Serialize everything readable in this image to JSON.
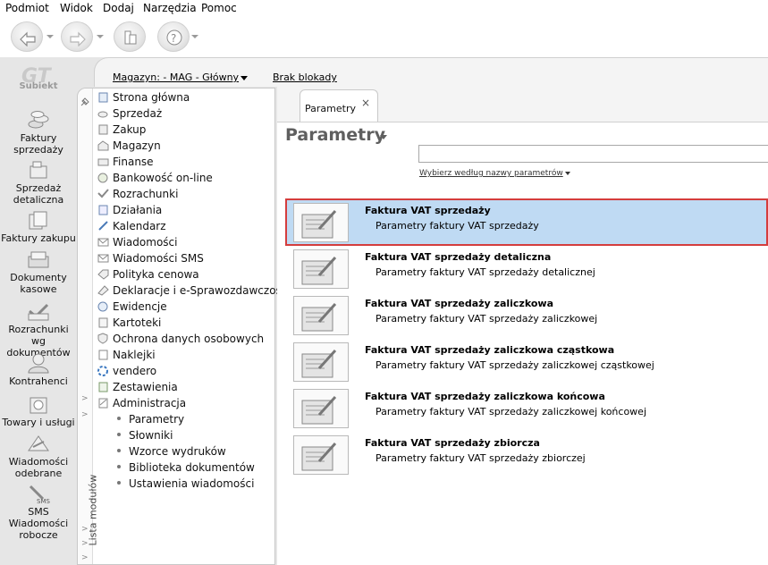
{
  "menu": [
    "Podmiot",
    "Widok",
    "Dodaj",
    "Narzędzia",
    "Pomoc"
  ],
  "logo_text": "Subiekt",
  "modules": [
    {
      "label": "Faktury sprzedaży",
      "icon": "coins-icon"
    },
    {
      "label": "Sprzedaż detaliczna",
      "icon": "cash-register-icon"
    },
    {
      "label": "Faktury zakupu",
      "icon": "invoice-stack-icon"
    },
    {
      "label": "Dokumenty kasowe",
      "icon": "cash-documents-icon"
    },
    {
      "label": "Rozrachunki wg dokumentów",
      "icon": "settlements-icon"
    },
    {
      "label": "Kontrahenci",
      "icon": "contractor-icon"
    },
    {
      "label": "Towary i usługi",
      "icon": "goods-icon"
    },
    {
      "label": "Wiadomości odebrane",
      "icon": "inbox-icon"
    },
    {
      "label": "SMS Wiadomości robocze",
      "icon": "sms-draft-icon"
    }
  ],
  "header": {
    "warehouse": "Magazyn: - MAG - Główny",
    "lock_status": "Brak blokady"
  },
  "nav": {
    "vertical_label": "Lista modułów",
    "items": [
      "Strona główna",
      "Sprzedaż",
      "Zakup",
      "Magazyn",
      "Finanse",
      "Bankowość on-line",
      "Rozrachunki",
      "Działania",
      "Kalendarz",
      "Wiadomości",
      "Wiadomości SMS",
      "Polityka cenowa",
      "Deklaracje i e-Sprawozdawczość",
      "Ewidencje",
      "Kartoteki",
      "Ochrona danych osobowych",
      "Naklejki",
      "vendero",
      "Zestawienia",
      "Administracja"
    ],
    "subitems": [
      "Parametry",
      "Słowniki",
      "Wzorce wydruków",
      "Biblioteka dokumentów",
      "Ustawienia wiadomości"
    ]
  },
  "tab": {
    "label": "Parametry",
    "close": "×"
  },
  "page": {
    "title": "Parametry",
    "search_value": "",
    "filter_label": "Wybierz według nazwy parametrów"
  },
  "rows": [
    {
      "title": "Faktura VAT sprzedaży",
      "desc": "Parametry faktury VAT sprzedaży"
    },
    {
      "title": "Faktura VAT sprzedaży detaliczna",
      "desc": "Parametry faktury VAT sprzedaży detalicznej"
    },
    {
      "title": "Faktura VAT sprzedaży zaliczkowa",
      "desc": "Parametry faktury VAT sprzedaży zaliczkowej"
    },
    {
      "title": "Faktura VAT sprzedaży zaliczkowa cząstkowa",
      "desc": "Parametry faktury VAT sprzedaży zaliczkowej cząstkowej"
    },
    {
      "title": "Faktura VAT sprzedaży zaliczkowa końcowa",
      "desc": "Parametry faktury VAT sprzedaży zaliczkowej końcowej"
    },
    {
      "title": "Faktura VAT sprzedaży zbiorcza",
      "desc": "Parametry faktury VAT sprzedaży zbiorczej"
    }
  ],
  "colors": {
    "selection": "#bfdaf3",
    "highlight_border": "#d43d3d",
    "frame": "#e6e6e6"
  }
}
